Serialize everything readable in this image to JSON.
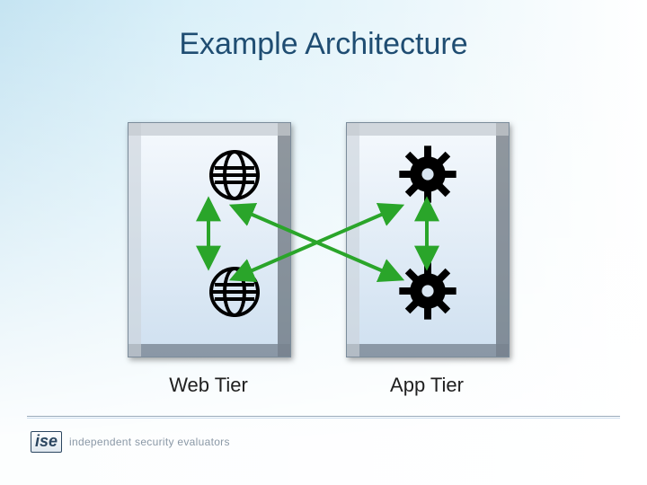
{
  "title": "Example Architecture",
  "left_tier_label": "Web Tier",
  "right_tier_label": "App Tier",
  "footer": {
    "company_abbrev": "ise",
    "company_tagline": "independent security evaluators"
  },
  "icons": {
    "web_top": "globe-icon",
    "web_bottom": "globe-icon",
    "app_top": "gear-icon",
    "app_bottom": "gear-icon"
  },
  "arrows": {
    "color": "#2aa52a",
    "description": "Top web globe links vertically down to bottom web globe; top app gear links vertically down to bottom app gear; bottom web globe and bottom app gear cross-link to opposite top icons forming an X."
  }
}
